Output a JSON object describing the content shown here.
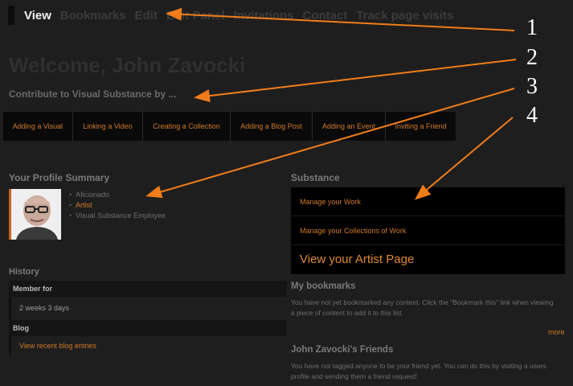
{
  "nav": {
    "tabs": [
      {
        "label": "View"
      },
      {
        "label": "Bookmarks"
      },
      {
        "label": "Edit"
      },
      {
        "label": "Edit Panel"
      },
      {
        "label": "Invitations"
      },
      {
        "label": "Contact"
      },
      {
        "label": "Track page visits"
      }
    ]
  },
  "page": {
    "title": "Welcome, John Zavocki",
    "contribute_label": "Contribute to Visual Substance by ..."
  },
  "actions": [
    {
      "label": "Adding a Visual"
    },
    {
      "label": "Linking a Video"
    },
    {
      "label": "Creating a Collection"
    },
    {
      "label": "Adding a Blog Post"
    },
    {
      "label": "Adding an Event"
    },
    {
      "label": "Inviting a Friend"
    }
  ],
  "profile": {
    "heading": "Your Profile Summary",
    "roles": [
      "Aficionado",
      "Artist",
      "Visual Substance Employee"
    ]
  },
  "history": {
    "heading": "History",
    "member_for_label": "Member for",
    "member_for_value": "2 weeks 3 days",
    "blog_label": "Blog",
    "blog_link": "View recent blog entries"
  },
  "substance": {
    "heading": "Substance",
    "items": [
      "Manage your Work",
      "Manage your Collections of Work"
    ],
    "artist_page_link": "View your Artist Page"
  },
  "bookmarks": {
    "heading": "My bookmarks",
    "text": "You have not yet bookmarked any content. Click the \"Bookmark this\" link when viewing a piece of content to add it to this list.",
    "more_link": "more"
  },
  "friends": {
    "heading": "John Zavocki's Friends",
    "text": "You have not tagged anyone to be your friend yet. You can do this by visiting a users profile and sending them a friend request!"
  },
  "annotations": [
    "1",
    "2",
    "3",
    "4"
  ],
  "colors": {
    "accent": "#d07a28",
    "arrow": "#f07d1a",
    "background": "#1e1e1e",
    "panel": "#000000"
  }
}
